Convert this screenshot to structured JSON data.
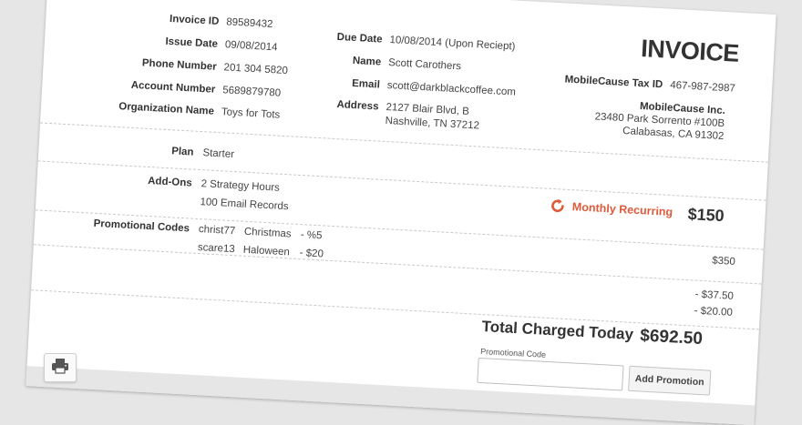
{
  "invoice": {
    "title": "INVOICE",
    "left_fields": [
      {
        "label": "Invoice ID",
        "value": "89589432"
      },
      {
        "label": "Issue Date",
        "value": "09/08/2014"
      },
      {
        "label": "Phone Number",
        "value": "201 304 5820"
      },
      {
        "label": "Account Number",
        "value": "5689879780"
      },
      {
        "label": "Organization Name",
        "value": "Toys for Tots"
      }
    ],
    "mid_fields": [
      {
        "label": "Due Date",
        "value": "10/08/2014 (Upon Reciept)"
      },
      {
        "label": "Name",
        "value": "Scott Carothers"
      },
      {
        "label": "Email",
        "value": "scott@darkblackcoffee.com"
      },
      {
        "label": "Address",
        "line1": "2127 Blair Blvd, B",
        "line2": "Nashville, TN 37212"
      }
    ],
    "tax": {
      "label": "MobileCause Tax ID",
      "value": "467-987-2987"
    },
    "company": {
      "name": "MobileCause Inc.",
      "line1": "23480 Park Sorrento #100B",
      "line2": "Calabasas, CA 91302"
    }
  },
  "plan": {
    "label": "Plan",
    "value": "Starter"
  },
  "addons": {
    "label": "Add-Ons",
    "items": [
      "2 Strategy Hours",
      "100 Email Records"
    ],
    "recurring_label": "Monthly Recurring",
    "recurring_price": "$150"
  },
  "promos": {
    "label": "Promotional Codes",
    "codes": [
      {
        "code": "christ77",
        "name": "Christmas",
        "discount": "- %5"
      },
      {
        "code": "scare13",
        "name": "Haloween",
        "discount": "- $20"
      }
    ],
    "addon_price": "$350",
    "deductions": [
      "- $37.50",
      "- $20.00"
    ]
  },
  "total": {
    "label": "Total Charged Today",
    "value": "$692.50"
  },
  "promo_form": {
    "caption": "Promotional Code",
    "placeholder": "",
    "button_label": "Add Promotion"
  }
}
